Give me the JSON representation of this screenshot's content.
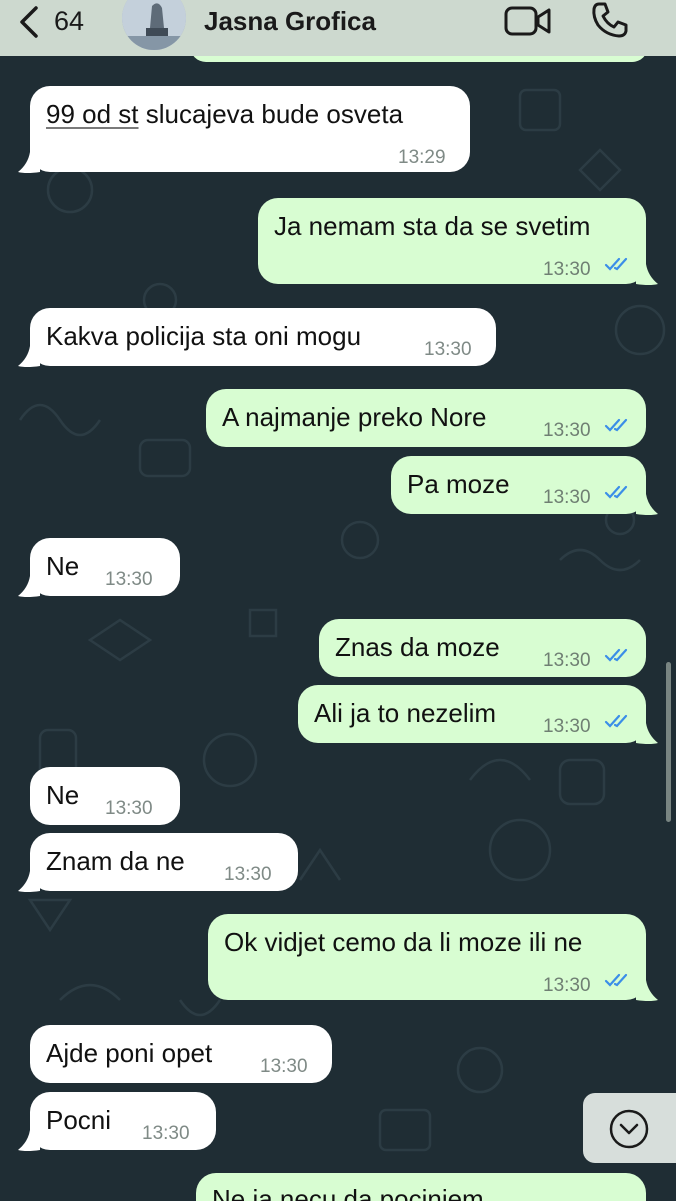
{
  "header": {
    "back_count": "64",
    "contact_name": "Jasna Grofica",
    "icons": {
      "back": "chevron-left-icon",
      "video": "video-camera-icon",
      "call": "phone-icon"
    }
  },
  "colors": {
    "chat_background": "#1f2d34",
    "incoming_bubble": "#ffffff",
    "outgoing_bubble": "#d8fdd2",
    "read_ticks": "#3b8ee8",
    "header": "#cdd9cf"
  },
  "messages": [
    {
      "direction": "in",
      "text_prefix": "99 od st",
      "text": " slucajeva bude osveta",
      "time": "13:29"
    },
    {
      "direction": "out",
      "text": "Ja nemam sta da se svetim",
      "time": "13:30",
      "read": true
    },
    {
      "direction": "in",
      "text": "Kakva policija sta oni mogu",
      "time": "13:30"
    },
    {
      "direction": "out",
      "text": "A najmanje preko Nore",
      "time": "13:30",
      "read": true
    },
    {
      "direction": "out",
      "text": "Pa moze",
      "time": "13:30",
      "read": true
    },
    {
      "direction": "in",
      "text": "Ne",
      "time": "13:30"
    },
    {
      "direction": "out",
      "text": "Znas da moze",
      "time": "13:30",
      "read": true
    },
    {
      "direction": "out",
      "text": "Ali ja to nezelim",
      "time": "13:30",
      "read": true
    },
    {
      "direction": "in",
      "text": "Ne",
      "time": "13:30"
    },
    {
      "direction": "in",
      "text": "Znam da ne",
      "time": "13:30"
    },
    {
      "direction": "out",
      "text": "Ok vidjet cemo da li moze ili ne",
      "time": "13:30",
      "read": true
    },
    {
      "direction": "in",
      "text": "Ajde poni opet",
      "time": "13:30"
    },
    {
      "direction": "in",
      "text": "Pocni",
      "time": "13:30"
    },
    {
      "direction": "out",
      "text": "Ne ja necu da pocinjem",
      "time": ""
    }
  ],
  "scroll_down_icon": "chevron-down-circle-icon"
}
